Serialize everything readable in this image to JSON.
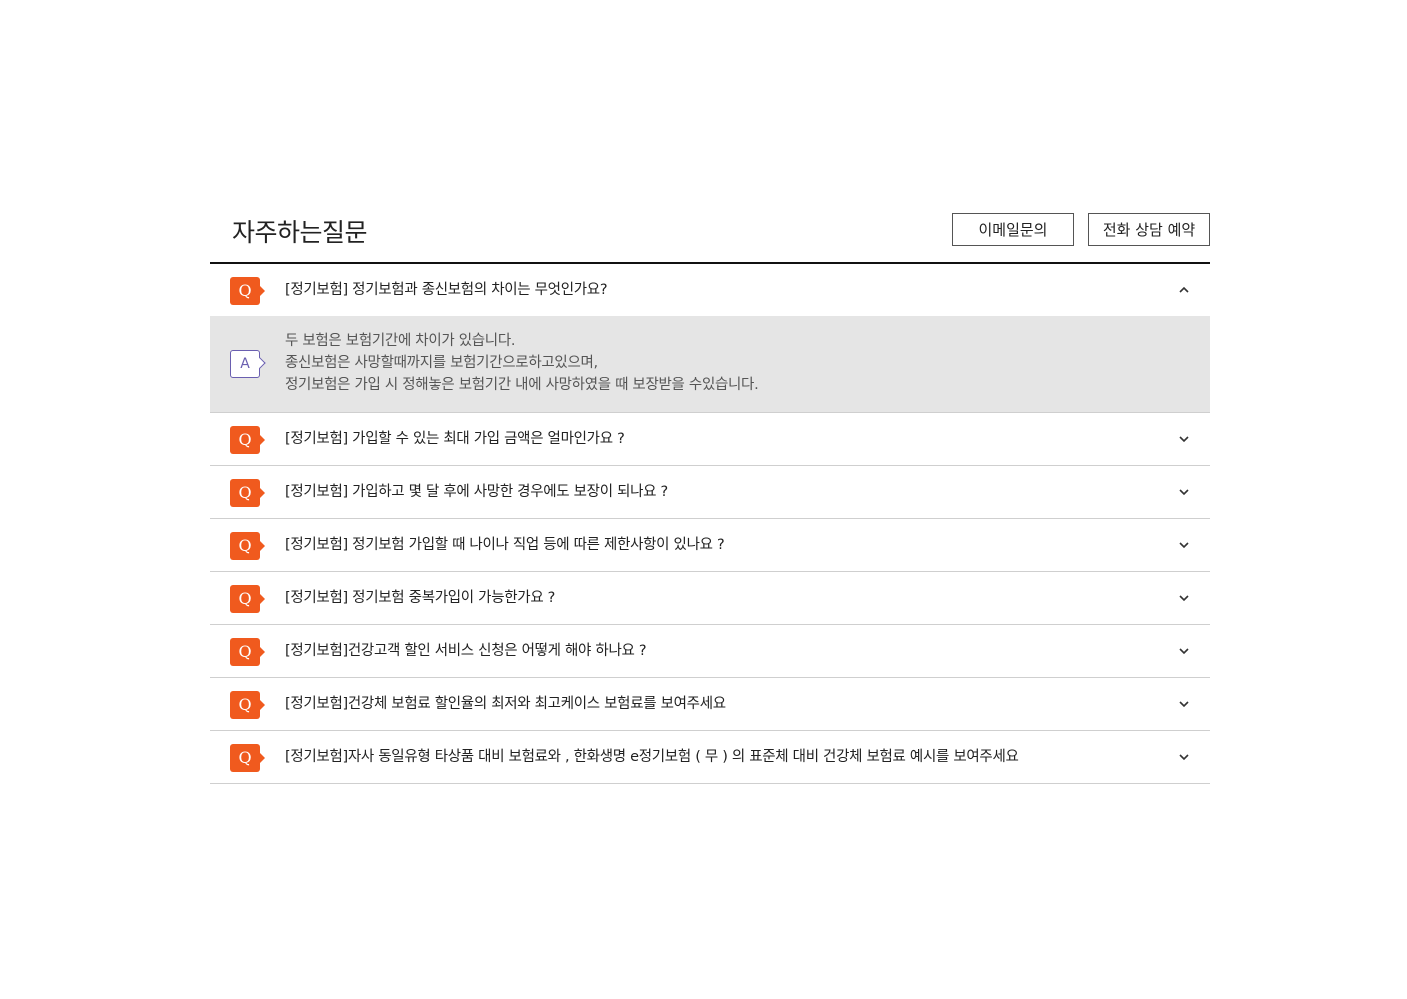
{
  "page": {
    "title": "자주하는질문",
    "email_button": "이메일문의",
    "phone_button": "전화 상담 예약"
  },
  "icons": {
    "question_badge": "Q",
    "answer_badge": "A"
  },
  "colors": {
    "accent": "#f05a1e",
    "answer_badge": "#6a5fb0",
    "answer_bg": "#e5e5e5"
  },
  "faq": {
    "open_question": "[정기보험] 정기보험과 종신보험의 차이는 무엇인가요?",
    "open_answer": [
      "두 보험은 보험기간에 차이가 있습니다.",
      "종신보험은 사망할때까지를 보험기간으로하고있으며,",
      "정기보험은 가입 시 정해놓은 보험기간 내에 사망하였을 때 보장받을 수있습니다."
    ],
    "questions": [
      "[정기보험] 가입할 수 있는 최대 가입 금액은 얼마인가요 ?",
      "[정기보험] 가입하고 몇 달 후에 사망한 경우에도 보장이 되나요 ?",
      "[정기보험] 정기보험 가입할 때 나이나 직업 등에 따른 제한사항이 있나요 ?",
      "[정기보험] 정기보험 중복가입이 가능한가요 ?",
      "[정기보험]건강고객 할인 서비스 신청은 어떻게 해야 하나요 ?",
      "[정기보험]건강체 보험료 할인율의 최저와 최고케이스 보험료를 보여주세요",
      "[정기보험]자사 동일유형 타상품 대비 보험료와 ,  한화생명 e정기보험 ( 무 ) 의 표준체 대비 건강체 보험료 예시를 보여주세요"
    ]
  }
}
